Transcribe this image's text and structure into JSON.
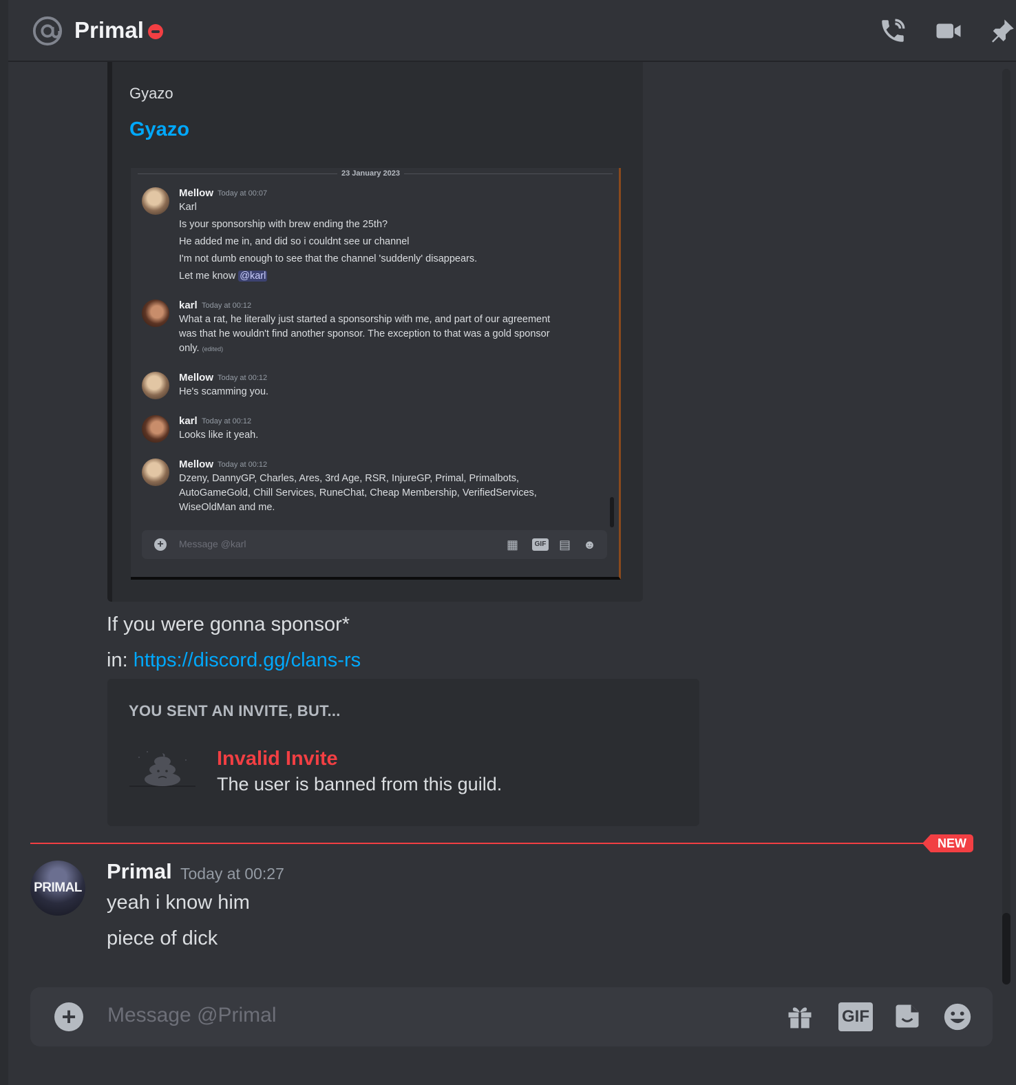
{
  "header": {
    "title": "Primal",
    "icons": [
      "at-icon",
      "dnd-status-icon",
      "voice-call-icon",
      "video-call-icon",
      "pin-icon"
    ]
  },
  "embed": {
    "provider": "Gyazo",
    "title": "Gyazo",
    "screenshot": {
      "date": "23 January 2023",
      "messages": [
        {
          "author": "Mellow",
          "time": "Today at 00:07",
          "lines": [
            "Karl",
            "Is your sponsorship with brew ending the 25th?",
            "He added me in, and did so i couldnt see ur channel",
            "I'm not dumb enough to see that the channel 'suddenly' disappears.",
            "Let me know"
          ],
          "mention": "@karl"
        },
        {
          "author": "karl",
          "time": "Today at 00:12",
          "lines": [
            "What a rat, he literally just started a sponsorship with me, and part of our agreement",
            "was that he wouldn't find another sponsor. The exception to that was a gold sponsor",
            "only."
          ],
          "edited": "(edited)"
        },
        {
          "author": "Mellow",
          "time": "Today at 00:12",
          "lines": [
            "He's scamming you."
          ]
        },
        {
          "author": "karl",
          "time": "Today at 00:12",
          "lines": [
            "Looks like it yeah."
          ]
        },
        {
          "author": "Mellow",
          "time": "Today at 00:12",
          "lines": [
            "Dzeny, DannyGP, Charles, Ares, 3rd Age, RSR, InjureGP, Primal, Primalbots,",
            "AutoGameGold, Chill Services, RuneChat, Cheap Membership, VerifiedServices,",
            "WiseOldMan and me."
          ]
        }
      ],
      "input_placeholder": "Message @karl",
      "gif_label": "GIF"
    }
  },
  "messages": {
    "line1": "If you were gonna sponsor*",
    "line2_prefix": "in: ",
    "line2_link": "https://discord.gg/clans-rs"
  },
  "invite": {
    "heading": "YOU SENT AN INVITE, BUT...",
    "title": "Invalid Invite",
    "subtitle": "The user is banned from this guild."
  },
  "divider": {
    "badge": "NEW"
  },
  "new_message": {
    "author": "Primal",
    "timestamp": "Today at 00:27",
    "avatar_text": "PRIMAL",
    "lines": [
      "yeah i know him",
      "piece of dick"
    ]
  },
  "composer": {
    "placeholder": "Message @Primal",
    "gif_label": "GIF"
  },
  "colors": {
    "background": "#313338",
    "link": "#00a8fc",
    "danger": "#f23f43",
    "embed_bg": "#2b2d31"
  }
}
